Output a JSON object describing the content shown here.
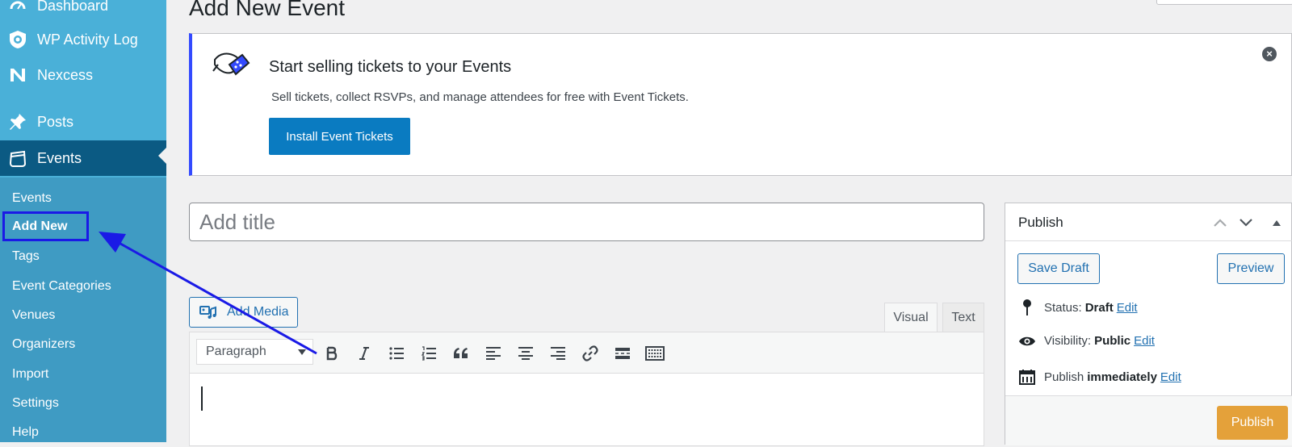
{
  "sidebar": {
    "top_items": [
      {
        "label": "Dashboard"
      },
      {
        "label": "WP Activity Log"
      },
      {
        "label": "Nexcess"
      },
      {
        "label": "Posts"
      },
      {
        "label": "Events"
      }
    ],
    "submenu": [
      {
        "label": "Events"
      },
      {
        "label": "Add New"
      },
      {
        "label": "Tags"
      },
      {
        "label": "Event Categories"
      },
      {
        "label": "Venues"
      },
      {
        "label": "Organizers"
      },
      {
        "label": "Import"
      },
      {
        "label": "Settings"
      },
      {
        "label": "Help"
      }
    ],
    "active_submenu": "Add New"
  },
  "page": {
    "title": "Add New Event"
  },
  "notice": {
    "title": "Start selling tickets to your Events",
    "text": "Sell tickets, collect RSVPs, and manage attendees for free with Event Tickets.",
    "button": "Install Event Tickets",
    "close_symbol": "×"
  },
  "title_field": {
    "placeholder": "Add title",
    "value": ""
  },
  "editor": {
    "add_media": "Add Media",
    "tabs": [
      "Visual",
      "Text"
    ],
    "active_tab": "Visual",
    "format_select": "Paragraph",
    "toolbar_icons": [
      "bold-icon",
      "italic-icon",
      "bullet-list-icon",
      "numbered-list-icon",
      "blockquote-icon",
      "align-left-icon",
      "align-center-icon",
      "align-right-icon",
      "link-icon",
      "read-more-icon",
      "toolbar-toggle-icon"
    ]
  },
  "publish": {
    "title": "Publish",
    "save_draft": "Save Draft",
    "preview": "Preview",
    "status_label": "Status:",
    "status_value": "Draft",
    "visibility_label": "Visibility:",
    "visibility_value": "Public",
    "schedule_label": "Publish",
    "schedule_value": "immediately",
    "edit_link": "Edit",
    "publish_button": "Publish"
  },
  "colors": {
    "sidebar_bg": "#4ab0d8",
    "sidebar_current": "#0b5a83",
    "submenu_bg": "#3f9bc3",
    "notice_accent": "#334aff",
    "primary_button": "#0a7bc1",
    "publish_button": "#e4a13a",
    "link": "#2271b1",
    "annotation": "#1a1ae6"
  }
}
